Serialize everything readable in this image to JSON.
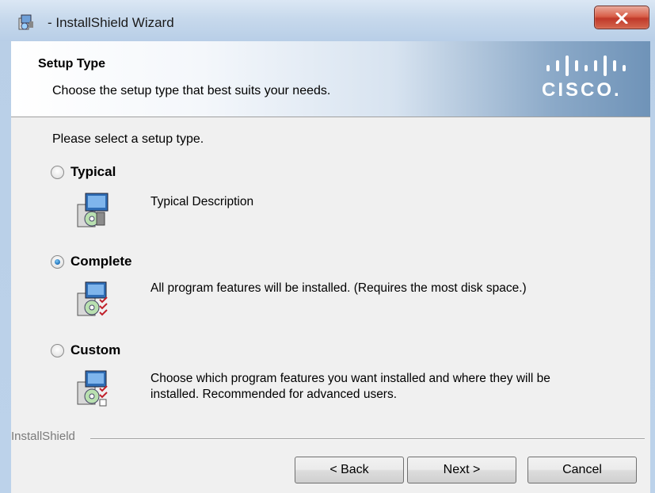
{
  "window": {
    "title": "- InstallShield Wizard",
    "close_glyph": "X"
  },
  "banner": {
    "title": "Setup Type",
    "subtitle": "Choose the setup type that best suits your needs.",
    "logo_text": "CISCO."
  },
  "prompt": "Please select a setup type.",
  "options": [
    {
      "label": "Typical",
      "selected": false,
      "description": "Typical Description",
      "icon": "typical-setup-icon"
    },
    {
      "label": "Complete",
      "selected": true,
      "description": "All program features will be installed. (Requires the most disk space.)",
      "icon": "complete-setup-icon"
    },
    {
      "label": "Custom",
      "selected": false,
      "description": "Choose which program features you want installed and where they will be installed. Recommended for advanced users.",
      "icon": "custom-setup-icon"
    }
  ],
  "footer": {
    "brand": "InstallShield",
    "back_label": "< Back",
    "next_label": "Next >",
    "cancel_label": "Cancel"
  },
  "colors": {
    "accent_radio": "#1e6fb8",
    "close_button": "#c7432f",
    "banner_gradient_end": "#6f93b8"
  }
}
